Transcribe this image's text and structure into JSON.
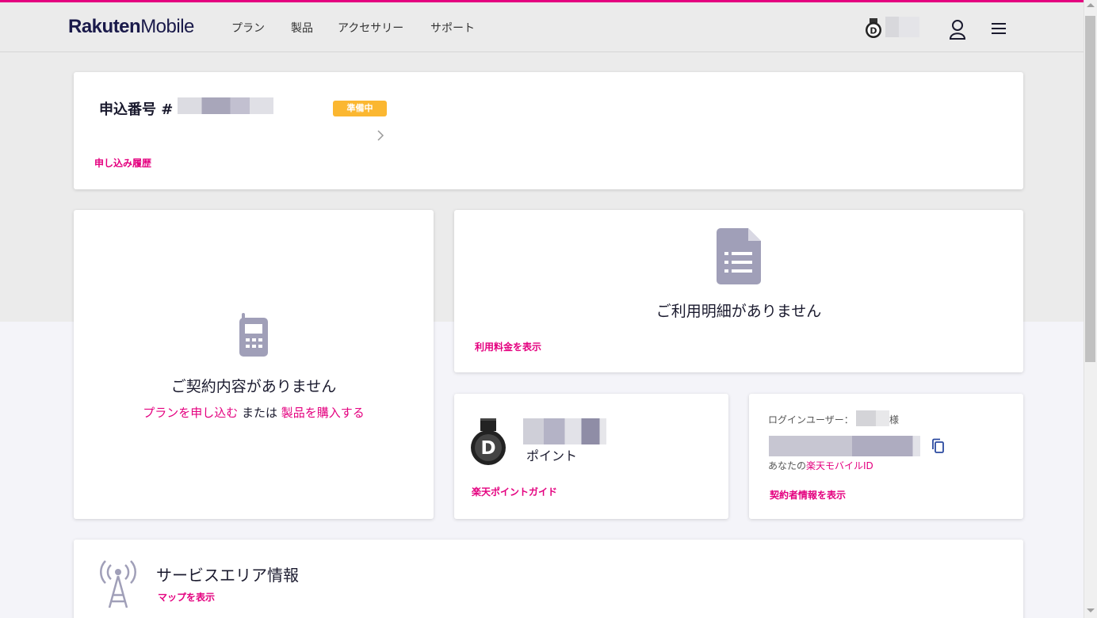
{
  "header": {
    "logo_bold": "Rakuten",
    "logo_light": "Mobile",
    "nav": [
      "プラン",
      "製品",
      "アクセサリー",
      "サポート"
    ],
    "badge_letter": "D"
  },
  "order": {
    "title": "申込番号 #",
    "status": "準備中",
    "history_link": "申し込み履歴"
  },
  "contract": {
    "empty_text": "ご契約内容がありません",
    "apply_link": "プランを申し込む",
    "or_text": " または ",
    "buy_link": "製品を購入する"
  },
  "statement": {
    "empty_text": "ご利用明細がありません",
    "link": "利用料金を表示"
  },
  "points": {
    "badge_letter": "D",
    "label": "ポイント",
    "link": "楽天ポイントガイド"
  },
  "login": {
    "label": "ログインユーザー：",
    "suffix": "様",
    "id_prefix": "あなたの",
    "id_link": "楽天モバイルID",
    "info_link": "契約者情報を表示"
  },
  "service": {
    "title": "サービスエリア情報",
    "link": "マップを表示"
  },
  "colors": {
    "accent": "#e4007f",
    "status": "#fbb731",
    "icon": "#a09fb8"
  }
}
